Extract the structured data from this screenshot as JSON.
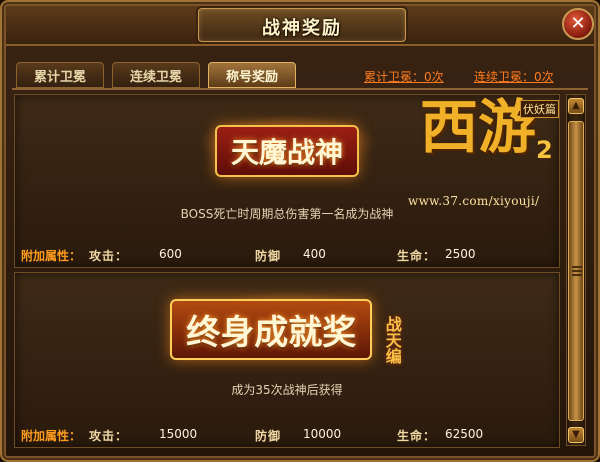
{
  "window": {
    "title": "战神奖励",
    "close_glyph": "✕"
  },
  "tabs": [
    {
      "label": "累计卫冕",
      "active": false
    },
    {
      "label": "连续卫冕",
      "active": false
    },
    {
      "label": "称号奖励",
      "active": true
    }
  ],
  "stats": {
    "cumulative": "累计卫冕：0次",
    "consecutive": "连续卫冕：0次"
  },
  "logo": {
    "main": "西游",
    "suffix": "2",
    "tag": "伏妖篇",
    "url": "www.37.com/xiyouji/"
  },
  "rewards": [
    {
      "title": "天魔战神",
      "side_text": "",
      "description": "BOSS死亡时周期总伤害第一名成为战神",
      "attr_label": "附加属性：",
      "attack_label": "攻击：",
      "attack": "600",
      "defense_label": "防御",
      "defense": "400",
      "hp_label": "生命：",
      "hp": "2500"
    },
    {
      "title": "终身成就奖",
      "side_text": "战天编",
      "description": "成为35次战神后获得",
      "attr_label": "附加属性：",
      "attack_label": "攻击：",
      "attack": "15000",
      "defense_label": "防御",
      "defense": "10000",
      "hp_label": "生命：",
      "hp": "62500"
    }
  ],
  "scrollbar": {
    "up_glyph": "▲",
    "down_glyph": "▼",
    "grip_glyph": "≡"
  },
  "colors": {
    "accent": "#ff7b1e",
    "gold": "#f0b028",
    "frame": "#a07434"
  }
}
